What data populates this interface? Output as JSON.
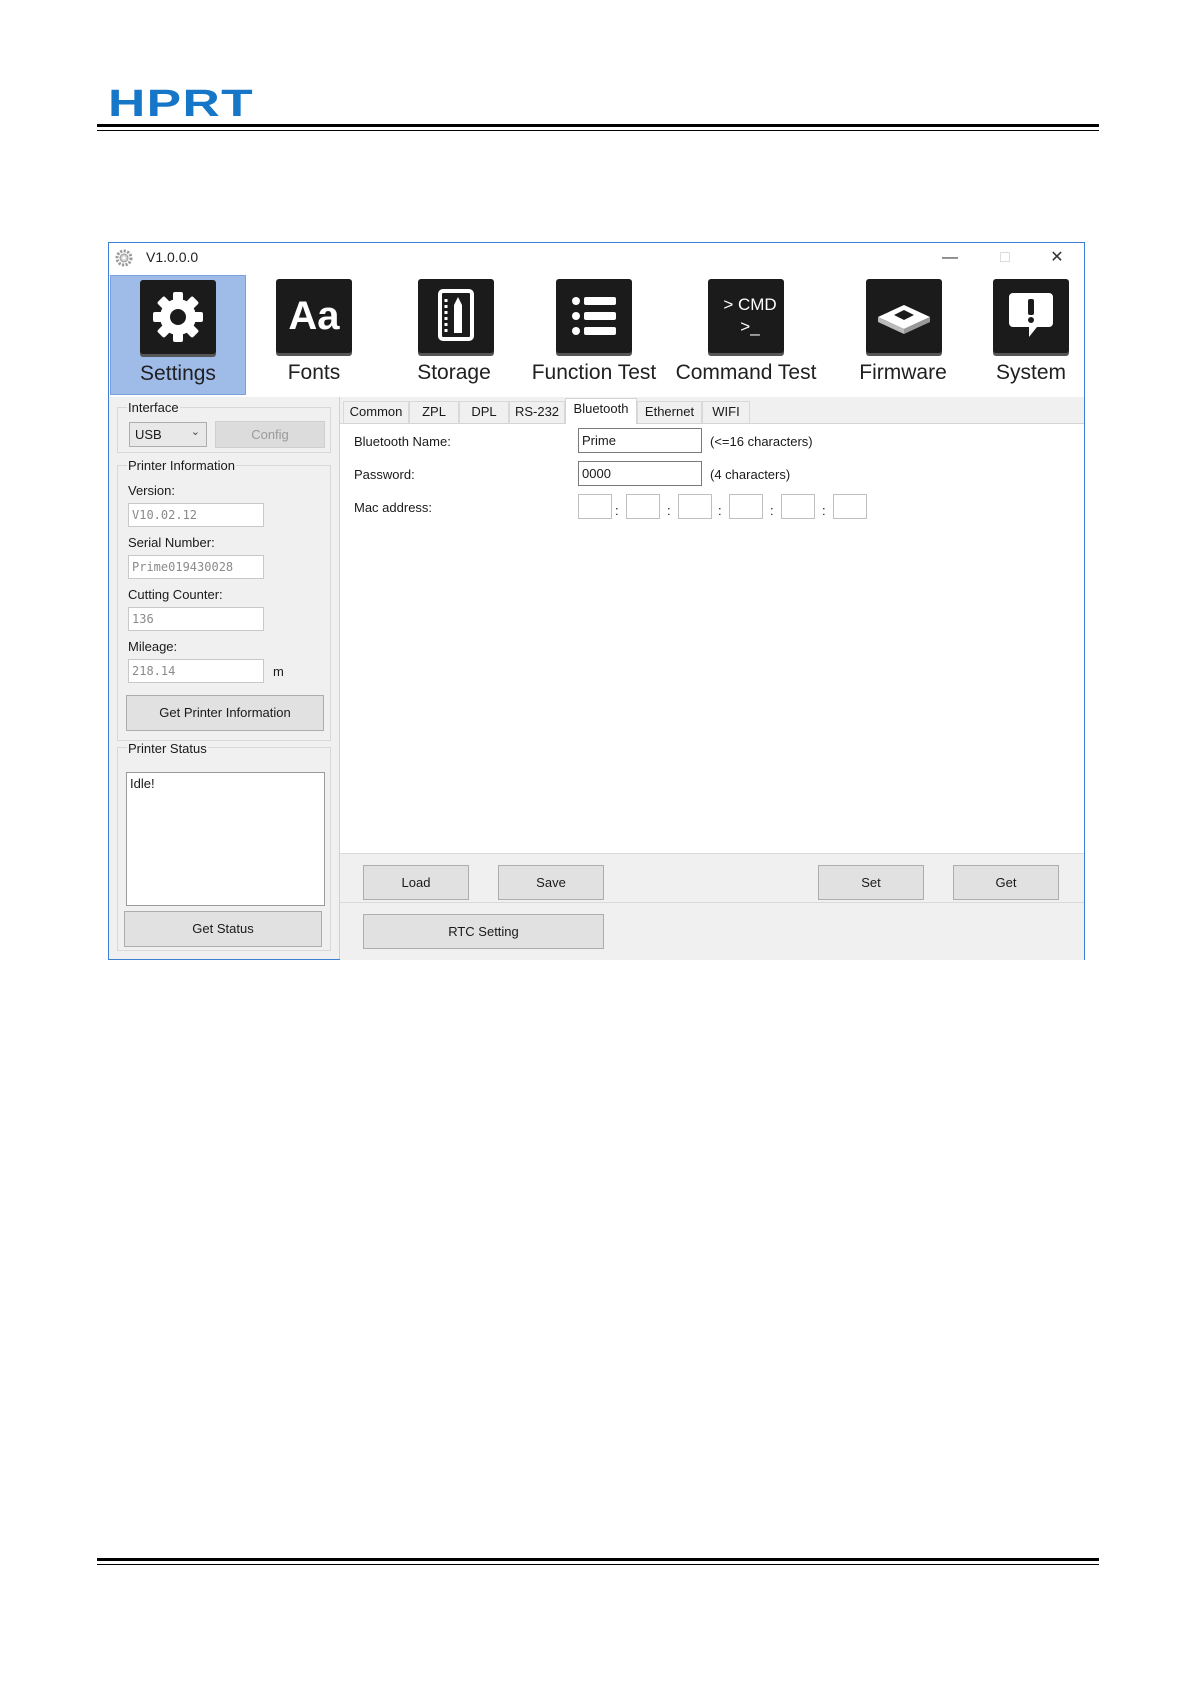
{
  "brand": {
    "logo_text": "HPRT",
    "color": "#1677c8"
  },
  "window": {
    "title": "V1.0.0.0",
    "controls": {
      "minimize": "—",
      "maximize": "□",
      "close": "✕"
    }
  },
  "toolbar": {
    "items": [
      {
        "label": "Settings",
        "icon": "gear-icon",
        "active": true
      },
      {
        "label": "Fonts",
        "icon": "font-icon",
        "icon_text": "Aa"
      },
      {
        "label": "Storage",
        "icon": "storage-icon"
      },
      {
        "label": "Function Test",
        "icon": "list-icon"
      },
      {
        "label": "Command Test",
        "icon": "terminal-icon",
        "icon_text": "> CMD",
        "icon_text2": ">_"
      },
      {
        "label": "Firmware",
        "icon": "chip-icon"
      },
      {
        "label": "System",
        "icon": "alert-icon"
      }
    ]
  },
  "left": {
    "interface_label": "Interface",
    "interface_value": "USB",
    "config_label": "Config",
    "printer_info_label": "Printer Information",
    "version_label": "Version:",
    "version_value": "V10.02.12",
    "serial_label": "Serial Number:",
    "serial_value": "Prime019430028",
    "cutting_label": "Cutting Counter:",
    "cutting_value": "136",
    "mileage_label": "Mileage:",
    "mileage_value": "218.14",
    "mileage_unit": "m",
    "get_info_label": "Get Printer Information",
    "status_label": "Printer Status",
    "status_value": "Idle!",
    "get_status_label": "Get Status"
  },
  "tabs": [
    "Common",
    "ZPL",
    "DPL",
    "RS-232",
    "Bluetooth",
    "Ethernet",
    "WIFI"
  ],
  "active_tab": "Bluetooth",
  "bluetooth": {
    "name_label": "Bluetooth Name:",
    "name_value": "Prime",
    "name_hint": "(<=16 characters)",
    "password_label": "Password:",
    "password_value": "0000",
    "password_hint": "(4 characters)",
    "mac_label": "Mac address:",
    "mac_sep": ":"
  },
  "actions": {
    "load": "Load",
    "save": "Save",
    "set": "Set",
    "get": "Get",
    "rtc": "RTC Setting"
  }
}
